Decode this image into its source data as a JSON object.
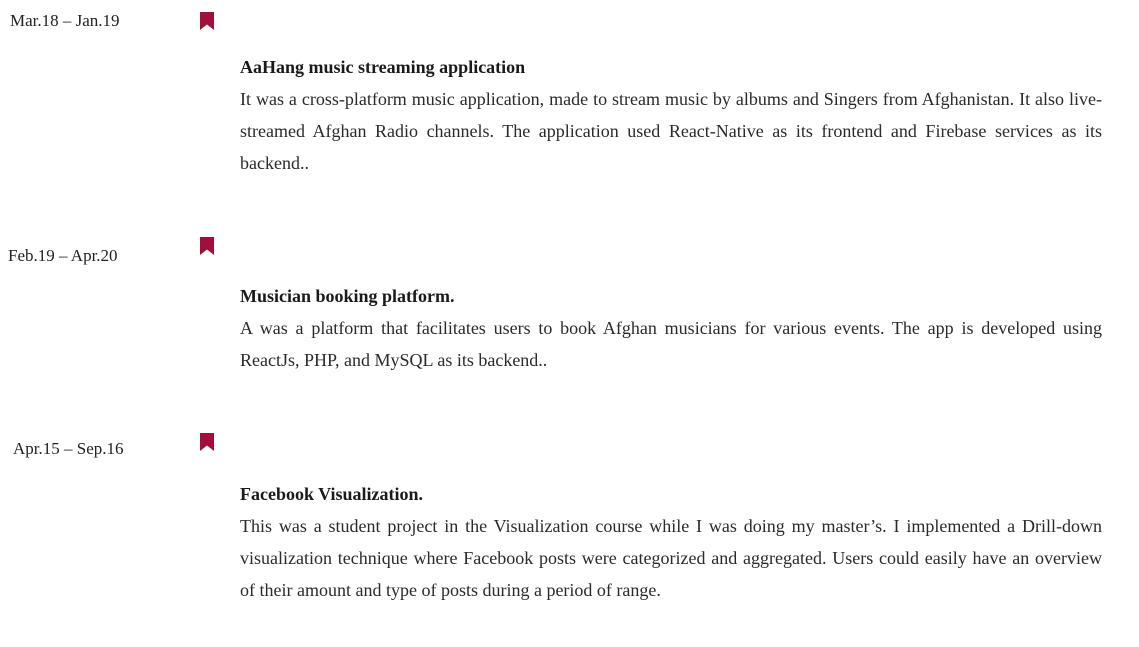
{
  "accent_color": "#a0103a",
  "projects": [
    {
      "date": "Mar.18 – Jan.19",
      "title": "AaHang music streaming application",
      "description": "It was a cross-platform music application, made to stream music by albums and Singers from Afghanistan. It also live-streamed Afghan Radio channels. The application used React-Native as its frontend and Firebase services as its backend..",
      "icon": "bookmark-icon"
    },
    {
      "date": "Feb.19 – Apr.20",
      "title": "Musician booking platform.",
      "description": "A was a platform that facilitates users to book Afghan musicians for various events. The app is developed using ReactJs, PHP, and MySQL as its backend..",
      "icon": "bookmark-icon"
    },
    {
      "date": "Apr.15 – Sep.16",
      "title": "Facebook Visualization.",
      "description": "This was a student project in the Visualization course while I was doing my master’s. I implemented a Drill-down visualization technique where Facebook posts were categorized and aggregated. Users could easily have an overview of their amount and type of posts during a period of range.",
      "icon": "bookmark-icon"
    }
  ]
}
